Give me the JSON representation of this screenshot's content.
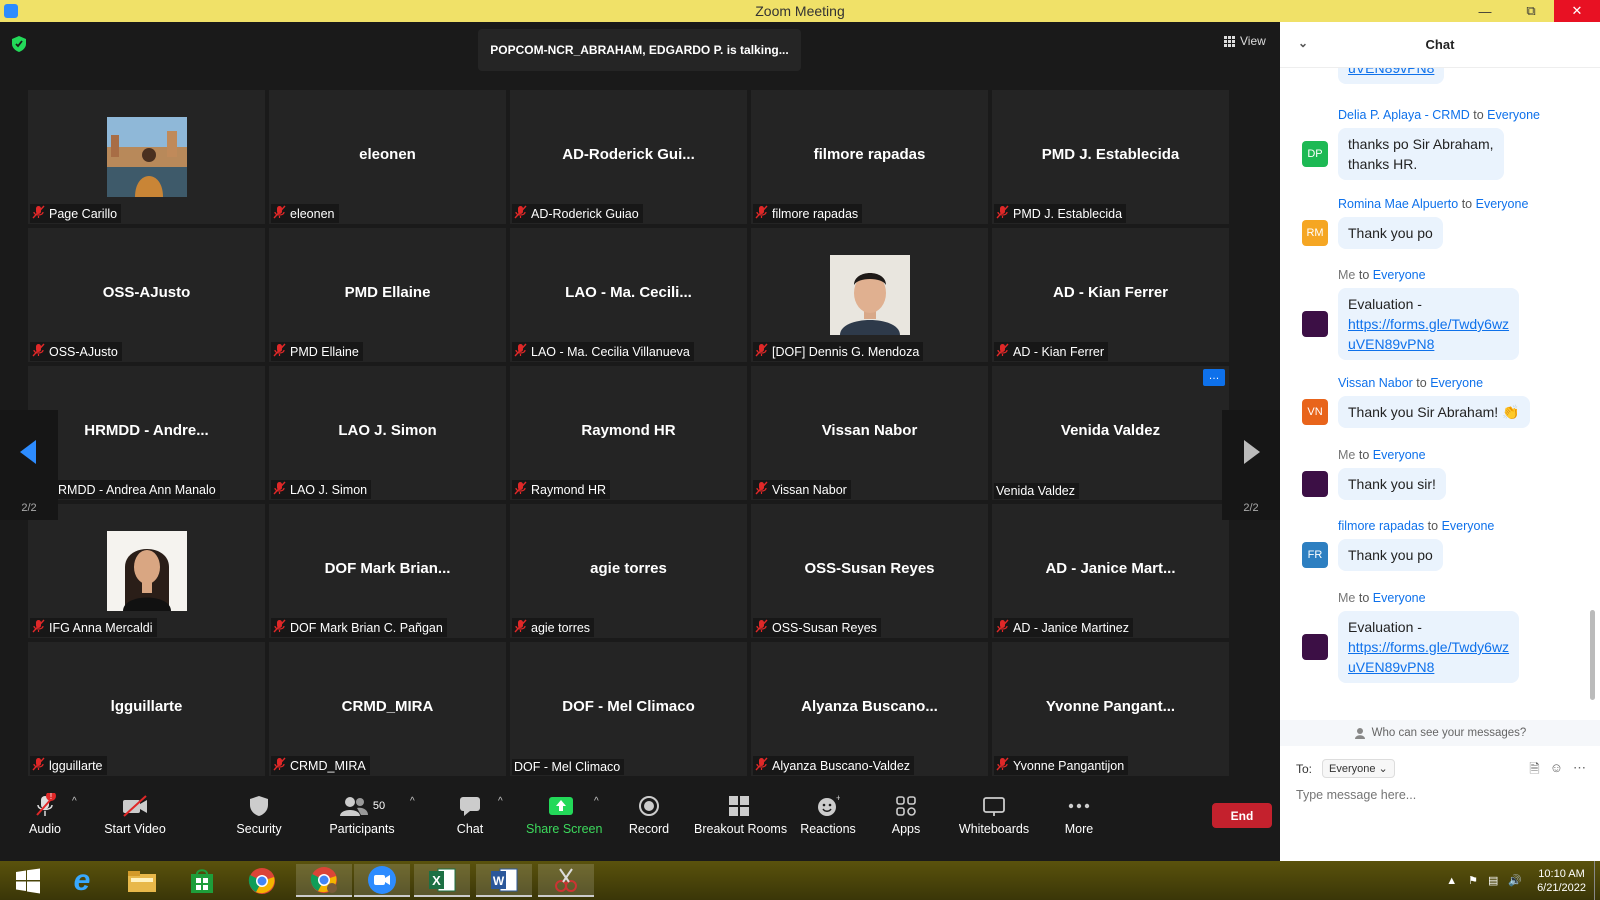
{
  "window": {
    "title": "Zoom Meeting"
  },
  "meeting": {
    "talking_banner": "POPCOM-NCR_ABRAHAM, EDGARDO P. is talking...",
    "view_label": "View",
    "page_indicator": "2/2",
    "tiles": [
      {
        "display": "",
        "label": "Page Carillo",
        "muted": true,
        "photo": "landscape"
      },
      {
        "display": "eleonen",
        "label": "eleonen",
        "muted": true
      },
      {
        "display": "AD-Roderick  Gui...",
        "label": "AD-Roderick Guiao",
        "muted": true
      },
      {
        "display": "filmore rapadas",
        "label": "filmore rapadas",
        "muted": true
      },
      {
        "display": "PMD J. Establecida",
        "label": "PMD J. Establecida",
        "muted": true
      },
      {
        "display": "OSS-AJusto",
        "label": "OSS-AJusto",
        "muted": true
      },
      {
        "display": "PMD Ellaine",
        "label": "PMD Ellaine",
        "muted": true
      },
      {
        "display": "LAO  - Ma. Cecili...",
        "label": "LAO - Ma. Cecilia Villanueva",
        "muted": true
      },
      {
        "display": "",
        "label": "[DOF] Dennis G. Mendoza",
        "muted": true,
        "photo": "man"
      },
      {
        "display": "AD - Kian Ferrer",
        "label": "AD - Kian Ferrer",
        "muted": true
      },
      {
        "display": "HRMDD  - Andre...",
        "label": "HRMDD - Andrea Ann Manalo",
        "muted": true
      },
      {
        "display": "LAO J. Simon",
        "label": "LAO J. Simon",
        "muted": true
      },
      {
        "display": "Raymond HR",
        "label": "Raymond HR",
        "muted": true
      },
      {
        "display": "Vissan Nabor",
        "label": "Vissan Nabor",
        "muted": true
      },
      {
        "display": "Venida Valdez",
        "label": "Venida Valdez",
        "muted": false,
        "more": true
      },
      {
        "display": "",
        "label": "IFG Anna Mercaldi",
        "muted": true,
        "photo": "woman"
      },
      {
        "display": "DOF Mark Brian...",
        "label": "DOF Mark Brian C. Pañgan",
        "muted": true
      },
      {
        "display": "agie torres",
        "label": "agie torres",
        "muted": true
      },
      {
        "display": "OSS-Susan Reyes",
        "label": "OSS-Susan Reyes",
        "muted": true
      },
      {
        "display": "AD - Janice Mart...",
        "label": "AD - Janice Martinez",
        "muted": true
      },
      {
        "display": "lgguillarte",
        "label": "lgguillarte",
        "muted": true
      },
      {
        "display": "CRMD_MIRA",
        "label": "CRMD_MIRA",
        "muted": true
      },
      {
        "display": "DOF - Mel Climaco",
        "label": "DOF - Mel Climaco",
        "muted": false
      },
      {
        "display": "Alyanza  Buscano...",
        "label": "Alyanza Buscano-Valdez",
        "muted": true
      },
      {
        "display": "Yvonne  Pangant...",
        "label": "Yvonne Pangantijon",
        "muted": true
      }
    ]
  },
  "toolbar": {
    "audio": "Audio",
    "start_video": "Start Video",
    "security": "Security",
    "participants": "Participants",
    "participants_count": "50",
    "chat": "Chat",
    "share_screen": "Share Screen",
    "record": "Record",
    "breakout_rooms": "Breakout Rooms",
    "reactions": "Reactions",
    "apps": "Apps",
    "whiteboards": "Whiteboards",
    "more": "More",
    "end": "End"
  },
  "chat": {
    "title": "Chat",
    "top_link_fragment": "uVEN89vPN8",
    "messages": [
      {
        "sender": "Delia P. Aplaya - CRMD",
        "to_word": "to",
        "recipient": "Everyone",
        "initials": "DP",
        "avatar_color": "#1db954",
        "line1": "thanks po Sir Abraham,",
        "line2": "thanks HR."
      },
      {
        "sender": "Romina Mae Alpuerto",
        "to_word": "to",
        "recipient": "Everyone",
        "initials": "RM",
        "avatar_color": "#f5a623",
        "line1": "Thank you po"
      },
      {
        "sender": "Me",
        "to_word": "to",
        "recipient": "Everyone",
        "initials": "",
        "avatar_color": "#3c0f45",
        "line1": "Evaluation -",
        "link1": "https://forms.gle/Twdy6wz",
        "link2": "uVEN89vPN8"
      },
      {
        "sender": "Vissan Nabor",
        "to_word": "to",
        "recipient": "Everyone",
        "initials": "VN",
        "avatar_color": "#e8641b",
        "line1": "Thank you Sir Abraham! 👏"
      },
      {
        "sender": "Me",
        "to_word": "to",
        "recipient": "Everyone",
        "initials": "",
        "avatar_color": "#3c0f45",
        "line1": "Thank you sir!"
      },
      {
        "sender": "filmore rapadas",
        "to_word": "to",
        "recipient": "Everyone",
        "initials": "FR",
        "avatar_color": "#2d7fc1",
        "line1": "Thank you po"
      },
      {
        "sender": "Me",
        "to_word": "to",
        "recipient": "Everyone",
        "initials": "",
        "avatar_color": "#3c0f45",
        "line1": "Evaluation -",
        "link1": "https://forms.gle/Twdy6wz",
        "link2": "uVEN89vPN8"
      }
    ],
    "who_can_see": "Who can see your messages?",
    "to_label": "To:",
    "to_value": "Everyone",
    "input_placeholder": "Type message here..."
  },
  "taskbar": {
    "time": "10:10 AM",
    "date": "6/21/2022"
  }
}
